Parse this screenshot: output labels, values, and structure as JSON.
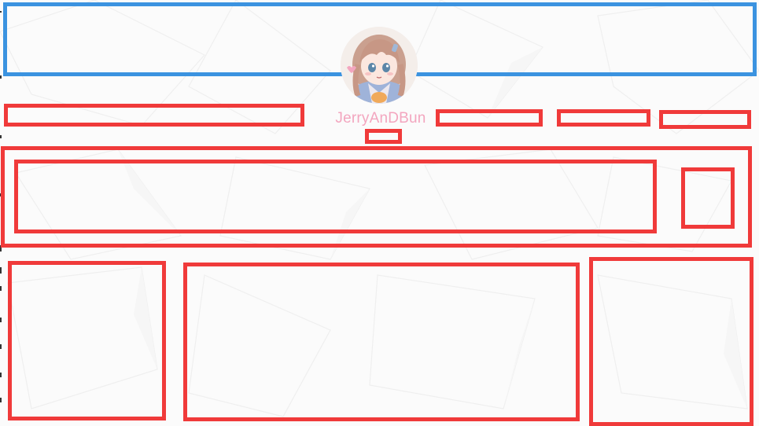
{
  "profile": {
    "username": "JerryAnDBun",
    "avatar_icon": "anime-girl-avatar-icon"
  },
  "colors": {
    "accent_red": "#f03a3a",
    "accent_blue": "#3b93e0",
    "username_pink": "#f3a6bf",
    "background": "#fbfbfb"
  }
}
